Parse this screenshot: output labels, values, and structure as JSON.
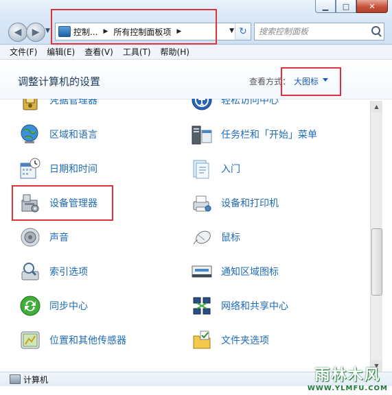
{
  "window": {
    "controls": {
      "minimize": "▁",
      "maximize": "□",
      "close": "✕"
    }
  },
  "nav": {
    "back": "◀",
    "forward": "▶",
    "dropdown": "▼"
  },
  "address": {
    "crumbs": [
      "控制...",
      "所有控制面板项"
    ],
    "separator": "▶",
    "refresh": "↻"
  },
  "search": {
    "placeholder": "搜索控制面板"
  },
  "menu": [
    "文件(F)",
    "编辑(E)",
    "查看(V)",
    "工具(T)",
    "帮助(H)"
  ],
  "header": {
    "title": "调整计算机的设置",
    "view_label": "查看方式：",
    "view_value": "大图标"
  },
  "items": [
    {
      "label": "凭据管理器",
      "icon": "credential-manager-icon"
    },
    {
      "label": "轻松访问中心",
      "icon": "ease-of-access-icon"
    },
    {
      "label": "区域和语言",
      "icon": "region-language-icon"
    },
    {
      "label": "任务栏和「开始」菜单",
      "icon": "taskbar-start-icon"
    },
    {
      "label": "日期和时间",
      "icon": "date-time-icon"
    },
    {
      "label": "入门",
      "icon": "getting-started-icon"
    },
    {
      "label": "设备管理器",
      "icon": "device-manager-icon"
    },
    {
      "label": "设备和打印机",
      "icon": "devices-printers-icon"
    },
    {
      "label": "声音",
      "icon": "sound-icon"
    },
    {
      "label": "鼠标",
      "icon": "mouse-icon"
    },
    {
      "label": "索引选项",
      "icon": "indexing-options-icon"
    },
    {
      "label": "通知区域图标",
      "icon": "notification-area-icon"
    },
    {
      "label": "同步中心",
      "icon": "sync-center-icon"
    },
    {
      "label": "网络和共享中心",
      "icon": "network-sharing-icon"
    },
    {
      "label": "位置和其他传感器",
      "icon": "location-sensors-icon"
    },
    {
      "label": "文件夹选项",
      "icon": "folder-options-icon"
    }
  ],
  "scrollbar": {
    "up": "▲",
    "down": "▼"
  },
  "status": {
    "text": "计算机"
  },
  "watermark": {
    "main": "雨林木风",
    "sub": "WWW.YLMFU.COM"
  },
  "colors": {
    "link": "#1f6bb5",
    "highlight": "#e0303a",
    "title": "#1e3a5a"
  }
}
